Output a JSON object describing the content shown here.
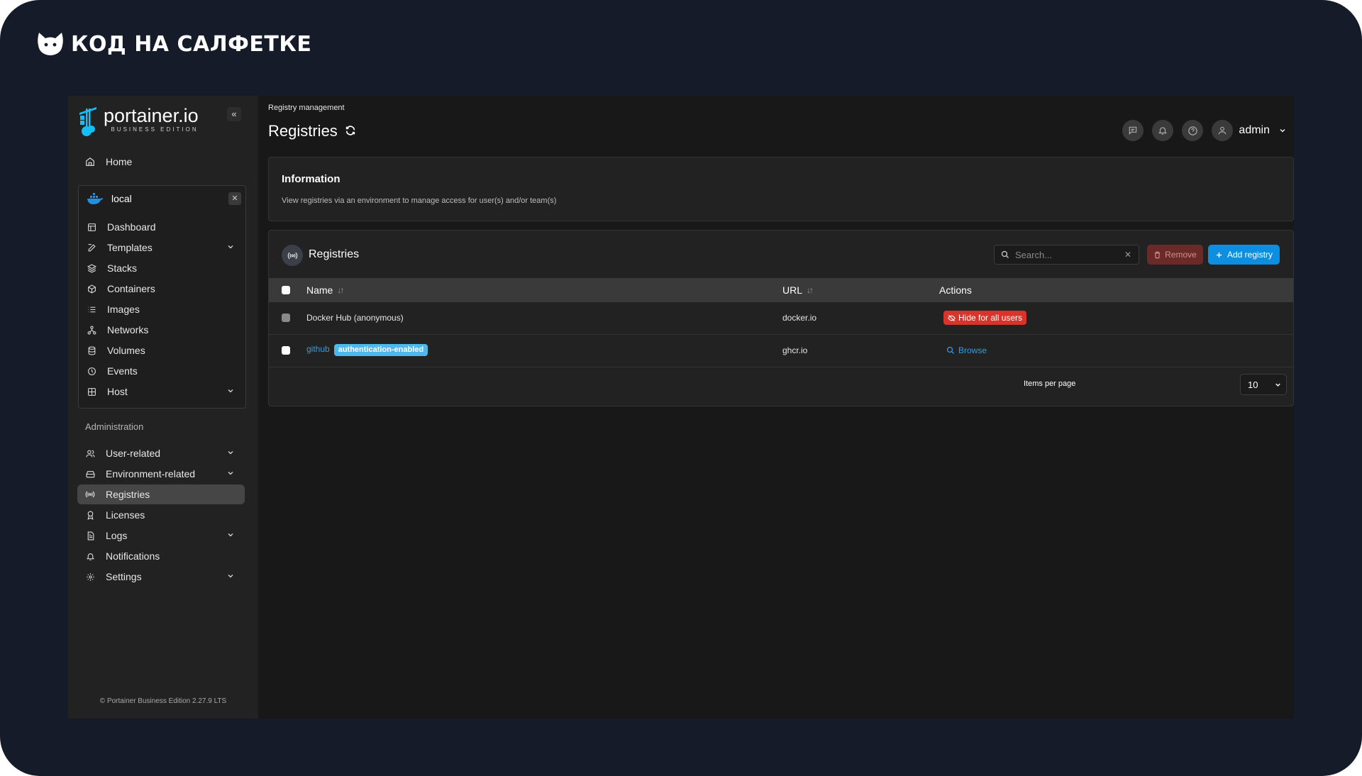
{
  "brand": {
    "text": "КОД НА САЛФЕТКЕ"
  },
  "sidebar": {
    "logo_title": "portainer.io",
    "logo_subtitle": "BUSINESS EDITION",
    "home_label": "Home",
    "environment": {
      "name": "local",
      "items": [
        {
          "label": "Dashboard",
          "icon": "dashboard-icon"
        },
        {
          "label": "Templates",
          "icon": "edit-icon",
          "expandable": true
        },
        {
          "label": "Stacks",
          "icon": "layers-icon"
        },
        {
          "label": "Containers",
          "icon": "box-icon"
        },
        {
          "label": "Images",
          "icon": "list-icon"
        },
        {
          "label": "Networks",
          "icon": "network-icon"
        },
        {
          "label": "Volumes",
          "icon": "database-icon"
        },
        {
          "label": "Events",
          "icon": "clock-icon"
        },
        {
          "label": "Host",
          "icon": "grid-icon",
          "expandable": true
        }
      ]
    },
    "admin_section_title": "Administration",
    "admin_items": [
      {
        "label": "User-related",
        "icon": "users-icon",
        "expandable": true
      },
      {
        "label": "Environment-related",
        "icon": "hard-drive-icon",
        "expandable": true
      },
      {
        "label": "Registries",
        "icon": "radio-icon",
        "active": true
      },
      {
        "label": "Licenses",
        "icon": "award-icon"
      },
      {
        "label": "Logs",
        "icon": "file-text-icon",
        "expandable": true
      },
      {
        "label": "Notifications",
        "icon": "bell-icon"
      },
      {
        "label": "Settings",
        "icon": "settings-icon",
        "expandable": true
      }
    ],
    "footer": "© Portainer Business Edition 2.27.9 LTS"
  },
  "header": {
    "breadcrumb": "Registry management",
    "title": "Registries",
    "user": "admin"
  },
  "info": {
    "title": "Information",
    "text": "View registries via an environment to manage access for user(s) and/or team(s)"
  },
  "registries": {
    "title": "Registries",
    "search_placeholder": "Search...",
    "remove_label": "Remove",
    "add_label": "Add registry",
    "columns": {
      "name": "Name",
      "url": "URL",
      "actions": "Actions"
    },
    "rows": [
      {
        "name": "Docker Hub (anonymous)",
        "url": "docker.io",
        "action": "Hide for all users"
      },
      {
        "name": "github",
        "badge": "authentication-enabled",
        "url": "ghcr.io",
        "action": "Browse"
      }
    ],
    "items_per_page_label": "Items per page",
    "items_per_page_value": "10"
  },
  "colors": {
    "accent": "#0c8fe0",
    "danger": "#d9342c",
    "badge": "#4db8ee"
  }
}
